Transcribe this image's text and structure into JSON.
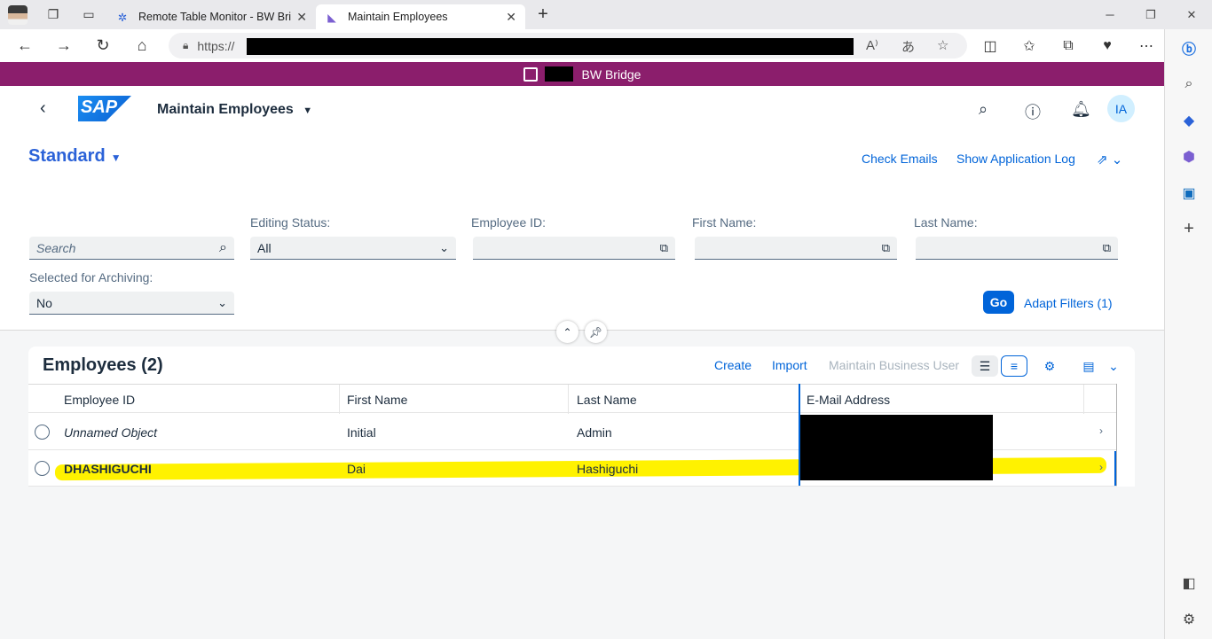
{
  "browser": {
    "tabs": [
      {
        "title": "Remote Table Monitor - BW Bridge"
      },
      {
        "title": "Maintain Employees"
      }
    ],
    "url": "https://"
  },
  "banner": {
    "title": "BW Bridge"
  },
  "shell": {
    "app_title": "Maintain Employees",
    "logo_text": "SAP",
    "user_initials": "IA"
  },
  "header": {
    "variant": "Standard",
    "links": [
      "Check Emails",
      "Show Application Log"
    ]
  },
  "filters": {
    "search_placeholder": "Search",
    "editing_status": {
      "label": "Editing Status:",
      "value": "All"
    },
    "employee_id": {
      "label": "Employee ID:"
    },
    "first_name": {
      "label": "First Name:"
    },
    "last_name": {
      "label": "Last Name:"
    },
    "archiving": {
      "label": "Selected for Archiving:",
      "value": "No"
    },
    "go_label": "Go",
    "adapt_label": "Adapt Filters (1)"
  },
  "table": {
    "title": "Employees (2)",
    "actions": {
      "create": "Create",
      "import": "Import",
      "maintain": "Maintain Business User"
    },
    "columns": [
      "Employee ID",
      "First Name",
      "Last Name",
      "E-Mail Address"
    ],
    "rows": [
      {
        "employee_id": "Unnamed Object",
        "first_name": "Initial",
        "last_name": "Admin"
      },
      {
        "employee_id": "DHASHIGUCHI",
        "first_name": "Dai",
        "last_name": "Hashiguchi"
      }
    ]
  }
}
